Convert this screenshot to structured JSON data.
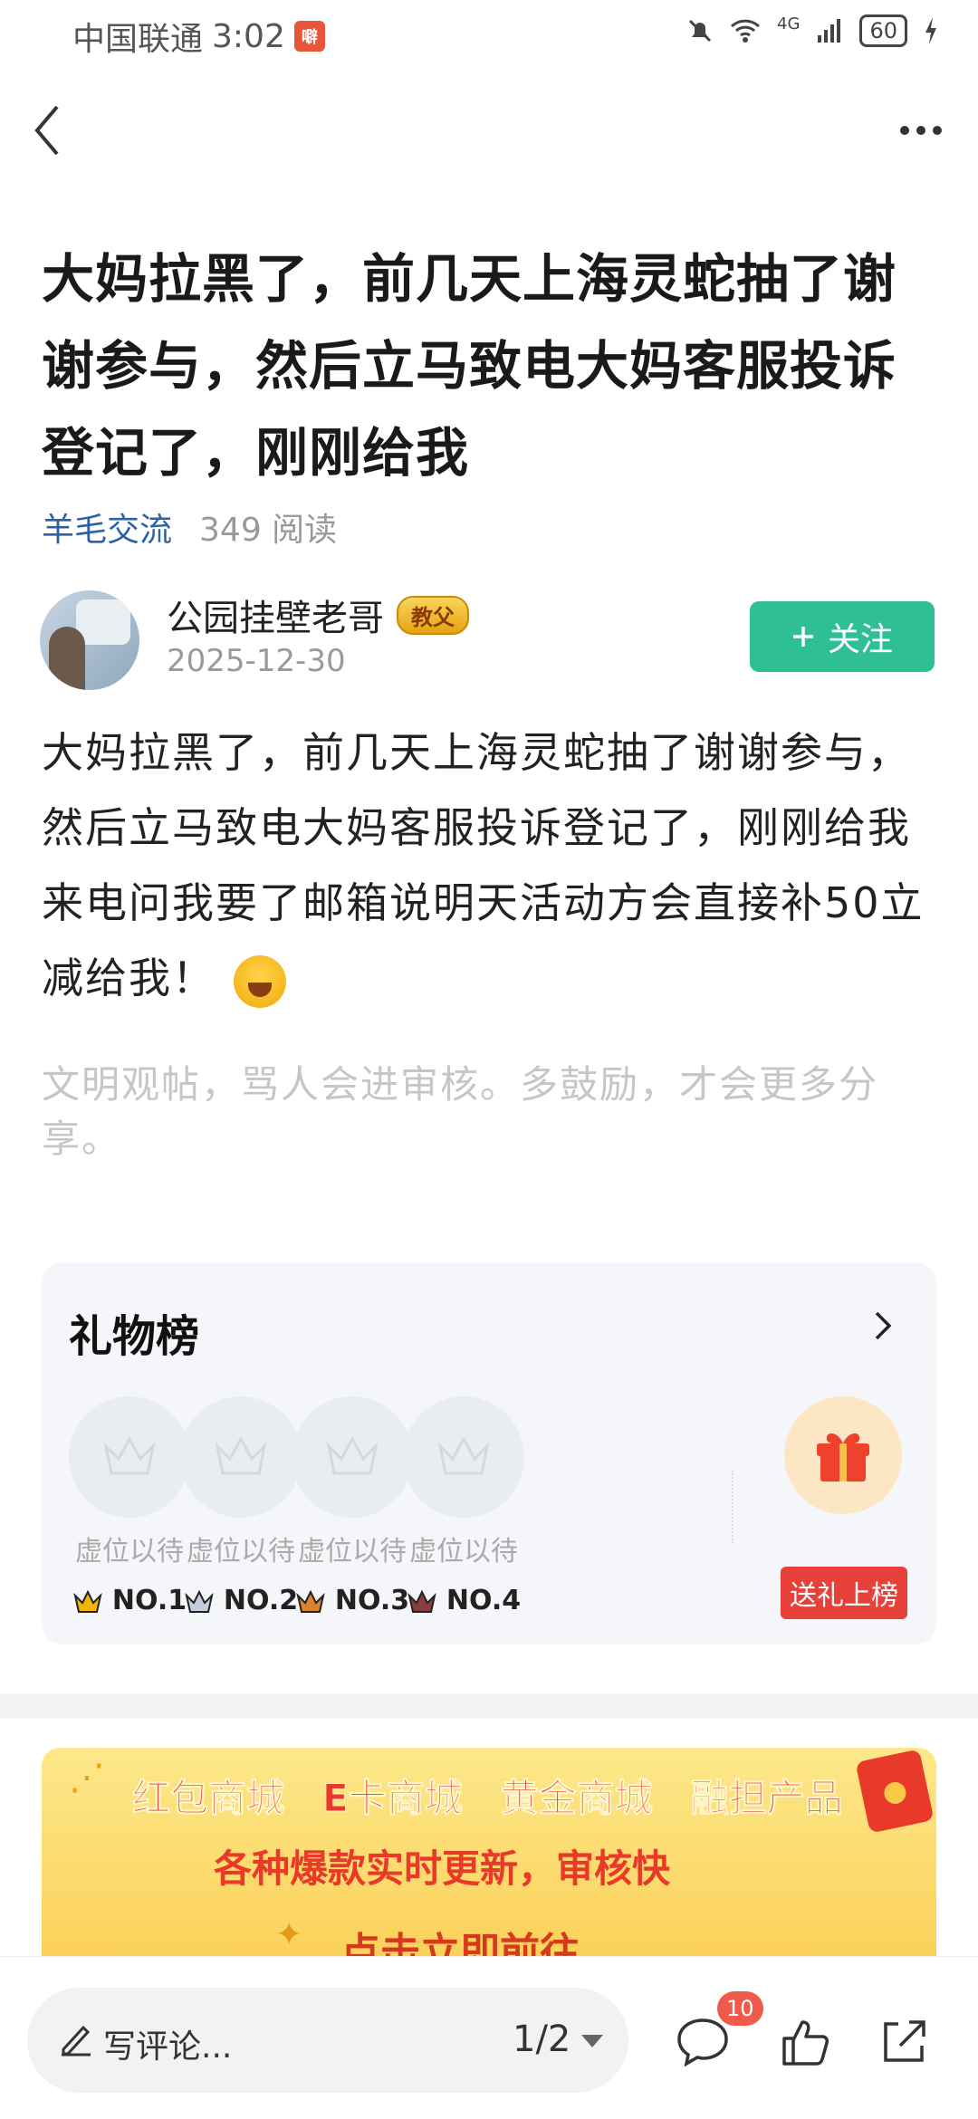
{
  "status_bar": {
    "carrier": "中国联通",
    "time": "3:02",
    "carrier_badge": "噼",
    "network": "4G",
    "battery": "60"
  },
  "article": {
    "title": "大妈拉黑了，前几天上海灵蛇抽了谢谢参与，然后立马致电大妈客服投诉登记了，刚刚给我",
    "category": "羊毛交流",
    "reads": "349 阅读",
    "author": "公园挂壁老哥",
    "author_badge": "教父",
    "date": "2025-12-30",
    "follow_label": "关注",
    "body": "大妈拉黑了，前几天上海灵蛇抽了谢谢参与，然后立马致电大妈客服投诉登记了，刚刚给我来电问我要了邮箱说明天活动方会直接补50立减给我！",
    "notice": "文明观帖，骂人会进审核。多鼓励，才会更多分享。"
  },
  "gift_board": {
    "title": "礼物榜",
    "slots": [
      {
        "label": "虚位以待",
        "rank": "NO.1",
        "crown_color": "#f2b705"
      },
      {
        "label": "虚位以待",
        "rank": "NO.2",
        "crown_color": "#7a8aa8"
      },
      {
        "label": "虚位以待",
        "rank": "NO.3",
        "crown_color": "#d9822b"
      },
      {
        "label": "虚位以待",
        "rank": "NO.4",
        "crown_color": "#8a3d3d"
      }
    ],
    "send_label": "送礼上榜"
  },
  "banner": {
    "items": [
      "红包商城",
      "E卡商城",
      "黄金商城",
      "融担产品"
    ],
    "line2": "各种爆款实时更新，审核快",
    "line3": "点击立即前往"
  },
  "bottom_bar": {
    "comment_placeholder": "写评论...",
    "page_indicator": "1/2",
    "comment_count": "10"
  }
}
